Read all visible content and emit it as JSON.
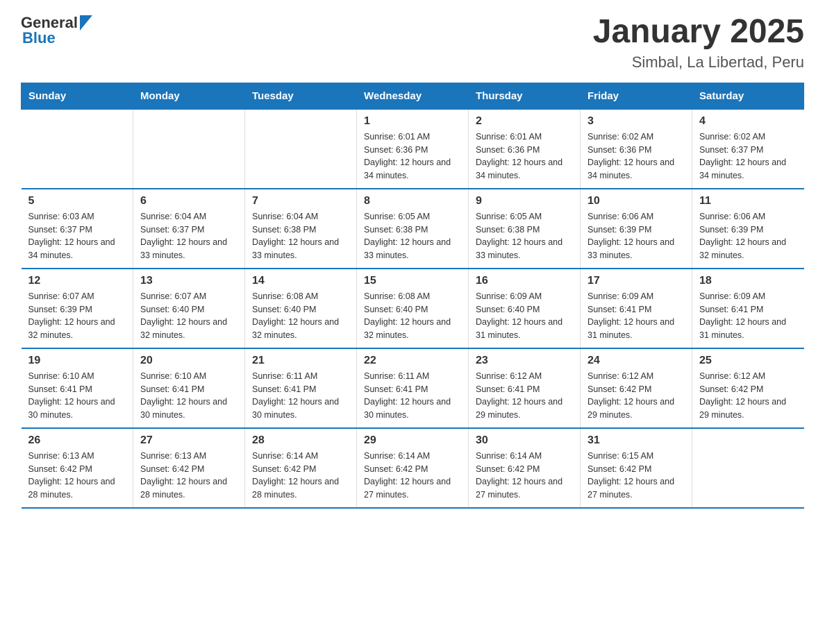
{
  "header": {
    "logo": {
      "text_general": "General",
      "text_blue": "Blue"
    },
    "title": "January 2025",
    "subtitle": "Simbal, La Libertad, Peru"
  },
  "calendar": {
    "weekdays": [
      "Sunday",
      "Monday",
      "Tuesday",
      "Wednesday",
      "Thursday",
      "Friday",
      "Saturday"
    ],
    "weeks": [
      [
        {
          "day": "",
          "sunrise": "",
          "sunset": "",
          "daylight": ""
        },
        {
          "day": "",
          "sunrise": "",
          "sunset": "",
          "daylight": ""
        },
        {
          "day": "",
          "sunrise": "",
          "sunset": "",
          "daylight": ""
        },
        {
          "day": "1",
          "sunrise": "Sunrise: 6:01 AM",
          "sunset": "Sunset: 6:36 PM",
          "daylight": "Daylight: 12 hours and 34 minutes."
        },
        {
          "day": "2",
          "sunrise": "Sunrise: 6:01 AM",
          "sunset": "Sunset: 6:36 PM",
          "daylight": "Daylight: 12 hours and 34 minutes."
        },
        {
          "day": "3",
          "sunrise": "Sunrise: 6:02 AM",
          "sunset": "Sunset: 6:36 PM",
          "daylight": "Daylight: 12 hours and 34 minutes."
        },
        {
          "day": "4",
          "sunrise": "Sunrise: 6:02 AM",
          "sunset": "Sunset: 6:37 PM",
          "daylight": "Daylight: 12 hours and 34 minutes."
        }
      ],
      [
        {
          "day": "5",
          "sunrise": "Sunrise: 6:03 AM",
          "sunset": "Sunset: 6:37 PM",
          "daylight": "Daylight: 12 hours and 34 minutes."
        },
        {
          "day": "6",
          "sunrise": "Sunrise: 6:04 AM",
          "sunset": "Sunset: 6:37 PM",
          "daylight": "Daylight: 12 hours and 33 minutes."
        },
        {
          "day": "7",
          "sunrise": "Sunrise: 6:04 AM",
          "sunset": "Sunset: 6:38 PM",
          "daylight": "Daylight: 12 hours and 33 minutes."
        },
        {
          "day": "8",
          "sunrise": "Sunrise: 6:05 AM",
          "sunset": "Sunset: 6:38 PM",
          "daylight": "Daylight: 12 hours and 33 minutes."
        },
        {
          "day": "9",
          "sunrise": "Sunrise: 6:05 AM",
          "sunset": "Sunset: 6:38 PM",
          "daylight": "Daylight: 12 hours and 33 minutes."
        },
        {
          "day": "10",
          "sunrise": "Sunrise: 6:06 AM",
          "sunset": "Sunset: 6:39 PM",
          "daylight": "Daylight: 12 hours and 33 minutes."
        },
        {
          "day": "11",
          "sunrise": "Sunrise: 6:06 AM",
          "sunset": "Sunset: 6:39 PM",
          "daylight": "Daylight: 12 hours and 32 minutes."
        }
      ],
      [
        {
          "day": "12",
          "sunrise": "Sunrise: 6:07 AM",
          "sunset": "Sunset: 6:39 PM",
          "daylight": "Daylight: 12 hours and 32 minutes."
        },
        {
          "day": "13",
          "sunrise": "Sunrise: 6:07 AM",
          "sunset": "Sunset: 6:40 PM",
          "daylight": "Daylight: 12 hours and 32 minutes."
        },
        {
          "day": "14",
          "sunrise": "Sunrise: 6:08 AM",
          "sunset": "Sunset: 6:40 PM",
          "daylight": "Daylight: 12 hours and 32 minutes."
        },
        {
          "day": "15",
          "sunrise": "Sunrise: 6:08 AM",
          "sunset": "Sunset: 6:40 PM",
          "daylight": "Daylight: 12 hours and 32 minutes."
        },
        {
          "day": "16",
          "sunrise": "Sunrise: 6:09 AM",
          "sunset": "Sunset: 6:40 PM",
          "daylight": "Daylight: 12 hours and 31 minutes."
        },
        {
          "day": "17",
          "sunrise": "Sunrise: 6:09 AM",
          "sunset": "Sunset: 6:41 PM",
          "daylight": "Daylight: 12 hours and 31 minutes."
        },
        {
          "day": "18",
          "sunrise": "Sunrise: 6:09 AM",
          "sunset": "Sunset: 6:41 PM",
          "daylight": "Daylight: 12 hours and 31 minutes."
        }
      ],
      [
        {
          "day": "19",
          "sunrise": "Sunrise: 6:10 AM",
          "sunset": "Sunset: 6:41 PM",
          "daylight": "Daylight: 12 hours and 30 minutes."
        },
        {
          "day": "20",
          "sunrise": "Sunrise: 6:10 AM",
          "sunset": "Sunset: 6:41 PM",
          "daylight": "Daylight: 12 hours and 30 minutes."
        },
        {
          "day": "21",
          "sunrise": "Sunrise: 6:11 AM",
          "sunset": "Sunset: 6:41 PM",
          "daylight": "Daylight: 12 hours and 30 minutes."
        },
        {
          "day": "22",
          "sunrise": "Sunrise: 6:11 AM",
          "sunset": "Sunset: 6:41 PM",
          "daylight": "Daylight: 12 hours and 30 minutes."
        },
        {
          "day": "23",
          "sunrise": "Sunrise: 6:12 AM",
          "sunset": "Sunset: 6:41 PM",
          "daylight": "Daylight: 12 hours and 29 minutes."
        },
        {
          "day": "24",
          "sunrise": "Sunrise: 6:12 AM",
          "sunset": "Sunset: 6:42 PM",
          "daylight": "Daylight: 12 hours and 29 minutes."
        },
        {
          "day": "25",
          "sunrise": "Sunrise: 6:12 AM",
          "sunset": "Sunset: 6:42 PM",
          "daylight": "Daylight: 12 hours and 29 minutes."
        }
      ],
      [
        {
          "day": "26",
          "sunrise": "Sunrise: 6:13 AM",
          "sunset": "Sunset: 6:42 PM",
          "daylight": "Daylight: 12 hours and 28 minutes."
        },
        {
          "day": "27",
          "sunrise": "Sunrise: 6:13 AM",
          "sunset": "Sunset: 6:42 PM",
          "daylight": "Daylight: 12 hours and 28 minutes."
        },
        {
          "day": "28",
          "sunrise": "Sunrise: 6:14 AM",
          "sunset": "Sunset: 6:42 PM",
          "daylight": "Daylight: 12 hours and 28 minutes."
        },
        {
          "day": "29",
          "sunrise": "Sunrise: 6:14 AM",
          "sunset": "Sunset: 6:42 PM",
          "daylight": "Daylight: 12 hours and 27 minutes."
        },
        {
          "day": "30",
          "sunrise": "Sunrise: 6:14 AM",
          "sunset": "Sunset: 6:42 PM",
          "daylight": "Daylight: 12 hours and 27 minutes."
        },
        {
          "day": "31",
          "sunrise": "Sunrise: 6:15 AM",
          "sunset": "Sunset: 6:42 PM",
          "daylight": "Daylight: 12 hours and 27 minutes."
        },
        {
          "day": "",
          "sunrise": "",
          "sunset": "",
          "daylight": ""
        }
      ]
    ]
  }
}
